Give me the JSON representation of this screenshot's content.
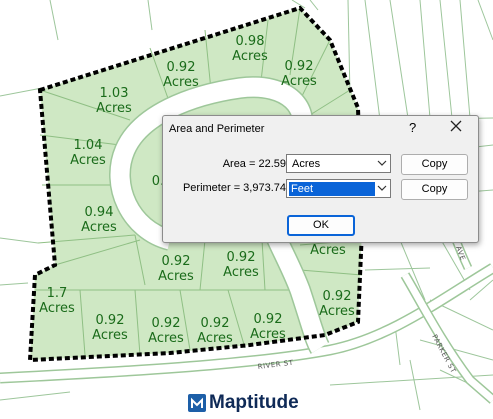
{
  "map": {
    "parcels": [
      {
        "id": "p1",
        "label_value": "0.98",
        "label_unit": "Acres"
      },
      {
        "id": "p2",
        "label_value": "0.92",
        "label_unit": "Acres"
      },
      {
        "id": "p3",
        "label_value": "0.92",
        "label_unit": "Acres"
      },
      {
        "id": "p4",
        "label_value": "1.03",
        "label_unit": "Acres"
      },
      {
        "id": "p5",
        "label_value": "1.04",
        "label_unit": "Acres"
      },
      {
        "id": "p6",
        "label_value": "0.94",
        "label_unit": "Acres"
      },
      {
        "id": "p7",
        "label_value": "0.92",
        "label_unit": "Acres"
      },
      {
        "id": "p8",
        "label_value": "0.92",
        "label_unit": "Acres"
      },
      {
        "id": "p9",
        "label_value": "1.7",
        "label_unit": "Acres"
      },
      {
        "id": "p10",
        "label_value": "0.92",
        "label_unit": "Acres"
      },
      {
        "id": "p11",
        "label_value": "0.92",
        "label_unit": "Acres"
      },
      {
        "id": "p12",
        "label_value": "0.92",
        "label_unit": "Acres"
      },
      {
        "id": "p13",
        "label_value": "0.92",
        "label_unit": "Acres"
      },
      {
        "id": "p14",
        "label_value": "0.92",
        "label_unit": "Acres"
      },
      {
        "id": "p15",
        "label_value": "",
        "label_unit": "Acres"
      },
      {
        "id": "p16",
        "label_value": "0.",
        "label_unit": ""
      }
    ],
    "streets": {
      "river": "RIVER ST",
      "parker": "PARKER ST",
      "ave": "AVE"
    },
    "colors": {
      "parcel_fill": "#cfe8c4",
      "parcel_line": "#8fbf84",
      "boundary": "#000000",
      "road": "#ffffff",
      "road_edge": "#9ec79a",
      "outside_line": "#9dc69b"
    }
  },
  "dialog": {
    "title": "Area and Perimeter",
    "help": "?",
    "area_label": "Area = 22.59",
    "area_unit": "Acres",
    "perimeter_label": "Perimeter = 3,973.74",
    "perimeter_unit": "Feet",
    "copy_label": "Copy",
    "ok_label": "OK"
  },
  "logo": {
    "text": "Maptitude",
    "icon": "maptitude-logo-icon"
  }
}
